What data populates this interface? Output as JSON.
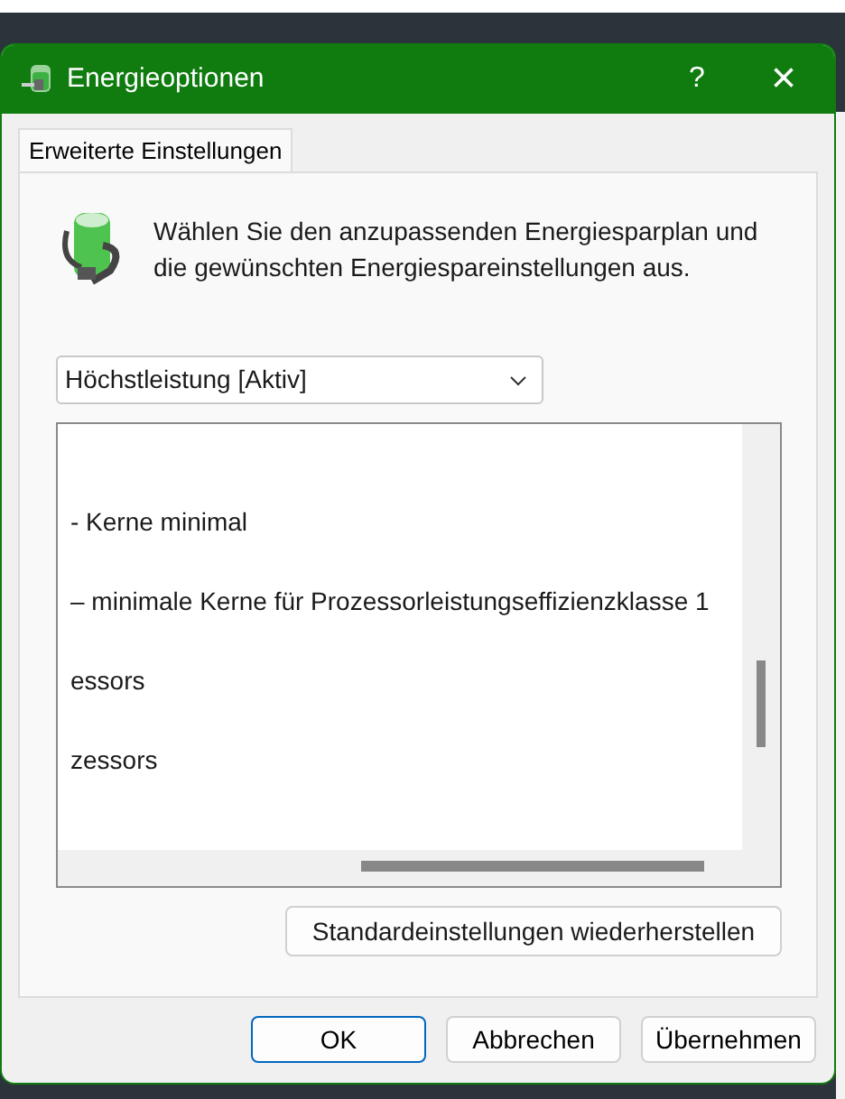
{
  "window": {
    "title": "Energieoptionen",
    "help": "?",
    "close": "×"
  },
  "tabs": [
    {
      "label": "Erweiterte Einstellungen",
      "selected": true
    }
  ],
  "intro": "Wählen Sie den anzupassenden Energiesparplan und die gewünschten Energiespareinstellungen aus.",
  "plan_select": {
    "value": "Höchstleistung [Aktiv]"
  },
  "settings_list": [
    "- Kerne minimal",
    "– minimale Kerne für Prozessorleistungseffizienzklasse 1",
    "essors",
    "zessors"
  ],
  "restore_button": "Standardeinstellungen wiederherstellen",
  "buttons": [
    {
      "label": "OK",
      "default": true
    },
    {
      "label": "Abbrechen",
      "default": false
    },
    {
      "label": "Übernehmen",
      "default": false
    }
  ]
}
